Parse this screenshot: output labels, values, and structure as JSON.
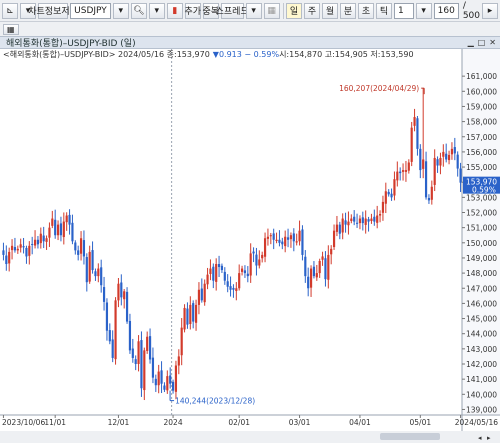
{
  "toolbar": {
    "save_label": "차트정보저장",
    "symbol_value": "USDJPY",
    "add_label": "추가",
    "overlay_label": "중복",
    "spread_label": "스프레드",
    "period_buttons": [
      "일",
      "주",
      "월",
      "분",
      "초",
      "틱"
    ],
    "interval_value": "1",
    "count_value": "160",
    "total_label": "/ 500"
  },
  "title": "해외통화(통합)–USDJPY-BID (일)",
  "info": {
    "prefix": "<해외통화(통합)–USDJPY-BID> 2024/05/16 종:153,970",
    "change": "▼0.913 − 0.59%",
    "rest": " 시:154,870 고:154,905 저:153,590"
  },
  "colors": {
    "up": "#d23a2b",
    "down": "#2a62c9",
    "last_price_bg": "#2a62c9",
    "marker": "#c0392b"
  },
  "chart_data": {
    "type": "candlestick",
    "title": "",
    "ylim": [
      138.7,
      162.0
    ],
    "y_ticks": [
      139,
      140,
      141,
      142,
      143,
      144,
      145,
      146,
      147,
      148,
      149,
      150,
      151,
      152,
      153,
      154,
      155,
      156,
      157,
      158,
      159,
      160,
      161
    ],
    "y_tick_labels": [
      "139,000",
      "140,000",
      "141,000",
      "142,000",
      "143,000",
      "144,000",
      "145,000",
      "146,000",
      "147,000",
      "148,000",
      "149,000",
      "150,000",
      "151,000",
      "152,000",
      "153,000",
      "154,000",
      "155,000",
      "156,000",
      "157,000",
      "158,000",
      "159,000",
      "160,000",
      "161,000"
    ],
    "x_labels": [
      {
        "label": "2023/10/06",
        "index": 0
      },
      {
        "label": "11/01",
        "index": 18
      },
      {
        "label": "12/01",
        "index": 40
      },
      {
        "label": "2024",
        "index": 59
      },
      {
        "label": "02/01",
        "index": 82
      },
      {
        "label": "03/01",
        "index": 103
      },
      {
        "label": "04/01",
        "index": 124
      },
      {
        "label": "05/01",
        "index": 145
      },
      {
        "label": "2024/05/16",
        "index": 159
      }
    ],
    "separator_index": 59,
    "closes": [
      149.2,
      148.6,
      149.4,
      149.8,
      149.5,
      149.6,
      149.9,
      149.7,
      149.1,
      149.8,
      149.9,
      150.2,
      149.9,
      150.6,
      150.1,
      150.3,
      151.0,
      151.6,
      150.5,
      151.2,
      150.5,
      151.4,
      151.8,
      151.2,
      150.1,
      149.5,
      149.2,
      150.3,
      149.1,
      147.4,
      149.4,
      148.2,
      147.8,
      148.3,
      147.2,
      146.1,
      144.2,
      143.5,
      142.4,
      146.2,
      147.3,
      146.4,
      146.8,
      144.8,
      142.9,
      142.4,
      142.0,
      143.5,
      140.4,
      142.9,
      143.8,
      142.3,
      141.1,
      140.6,
      141.5,
      140.7,
      140.3,
      141.2,
      140.7,
      140.244,
      141.9,
      142.5,
      144.4,
      145.7,
      144.6,
      145.9,
      144.8,
      145.9,
      146.9,
      146.2,
      147.3,
      147.9,
      148.3,
      147.5,
      148.6,
      148.4,
      148.2,
      147.5,
      147.1,
      146.9,
      146.9,
      147.0,
      148.0,
      148.3,
      148.0,
      147.8,
      149.3,
      149.3,
      148.5,
      148.9,
      149.2,
      150.3,
      150.4,
      150.5,
      150.2,
      150.2,
      150.0,
      149.9,
      150.4,
      150.2,
      150.5,
      150.1,
      150.1,
      150.8,
      149.2,
      147.8,
      147.0,
      148.3,
      147.8,
      148.0,
      148.8,
      149.1,
      147.6,
      149.2,
      149.6,
      150.8,
      151.2,
      150.6,
      151.6,
      151.2,
      151.4,
      151.6,
      151.4,
      151.3,
      151.6,
      151.3,
      151.6,
      151.4,
      151.6,
      151.4,
      151.8,
      151.9,
      152.7,
      153.4,
      153.2,
      153.0,
      154.2,
      154.7,
      154.6,
      154.8,
      154.8,
      155.3,
      157.6,
      158.3,
      156.2,
      154.8,
      155.5,
      153.0,
      152.8,
      153.7,
      155.6,
      155.1,
      155.6,
      156.0,
      155.5,
      155.8,
      156.2,
      155.9,
      154.9,
      153.97
    ],
    "high_marker": {
      "text": "160,207(2024/04/29)",
      "value": 160.207,
      "index": 146
    },
    "low_marker": {
      "text": "140,244(2023/12/28)",
      "value": 140.244,
      "index": 59
    },
    "last_price": {
      "value_label": "153,970",
      "change_label": "0.59%",
      "value": 153.97
    }
  }
}
